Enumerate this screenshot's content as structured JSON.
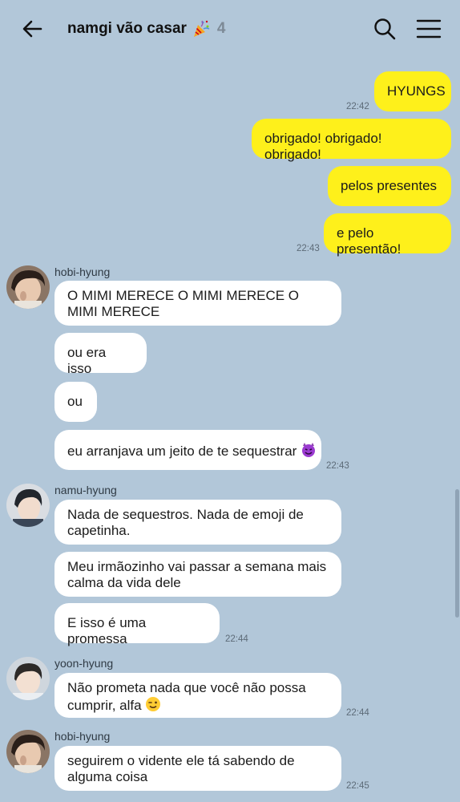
{
  "header": {
    "title": "namgi vão casar",
    "member_count": "4",
    "icons": [
      "back-arrow-icon",
      "party-popper-icon",
      "search-icon",
      "menu-icon"
    ]
  },
  "colors": {
    "background": "#b2c7d9",
    "outgoing_bubble": "#fef01b",
    "incoming_bubble": "#ffffff"
  },
  "messages": {
    "m1": "HYUNGS",
    "t1": "22:42",
    "m2": "obrigado! obrigado! obrigado!",
    "m3": "pelos presentes",
    "m4": "e pelo presentão!",
    "t2": "22:43",
    "s1": "hobi-hyung",
    "m5": "O MIMI MERECE O MIMI MERECE O MIMI MERECE",
    "m6": "ou era isso",
    "m7": "ou",
    "m8": "eu arranjava um jeito de te sequestrar",
    "t3": "22:43",
    "s2": "namu-hyung",
    "m9": "Nada de sequestros. Nada de emoji de capetinha.",
    "m10": "Meu irmãozinho vai passar a semana mais calma da vida dele",
    "m11": "E isso é uma promessa",
    "t4": "22:44",
    "s3": "yoon-hyung",
    "m12": "Não prometa nada que você não possa cumprir, alfa",
    "t5": "22:44",
    "s4": "hobi-hyung",
    "m13": "seguirem o vidente ele tá sabendo de alguma coisa",
    "t6": "22:45"
  },
  "emojis": {
    "m8": "smiling-devil-emoji",
    "m12": "winking-face-emoji"
  }
}
